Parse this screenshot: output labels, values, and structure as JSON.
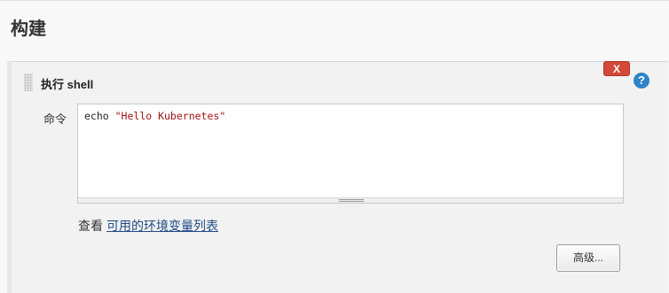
{
  "section": {
    "title": "构建"
  },
  "step": {
    "title": "执行 shell",
    "delete_label": "X",
    "help_label": "?",
    "command": {
      "label": "命令",
      "code_prefix": "echo ",
      "code_string": "\"Hello Kubernetes\""
    },
    "env": {
      "prefix": "查看",
      "link_text": "可用的环境变量列表"
    },
    "advanced_label": "高级..."
  },
  "colors": {
    "delete": "#d24939",
    "help": "#2e84c8",
    "link": "#204a87",
    "string": "#a31515"
  }
}
